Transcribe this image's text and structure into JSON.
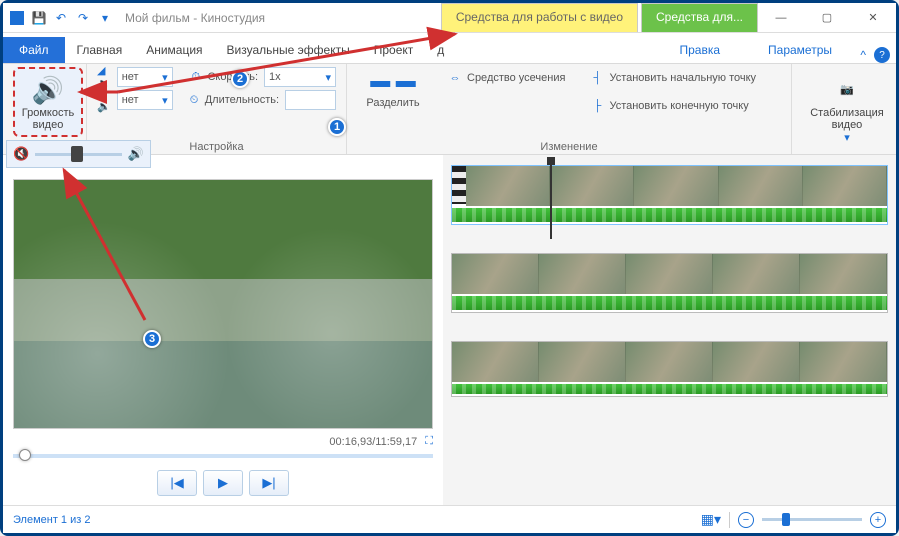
{
  "app": {
    "title": "Мой фильм - Киностудия",
    "context_tab_video": "Средства для работы с видео",
    "context_tab_more": "Средства для...",
    "win_min": "—",
    "win_max": "▢",
    "win_close": "✕"
  },
  "menu": {
    "file": "Файл",
    "home": "Главная",
    "anim": "Анимация",
    "vfx": "Визуальные эффекты",
    "project": "Проект",
    "d": "д",
    "edit": "Правка",
    "params": "Параметры",
    "collapse": "^"
  },
  "ribbon": {
    "volume_btn": "Громкость\nвидео",
    "fade_in": "нет",
    "fade_out": "нет",
    "speed_label": "Скорость:",
    "speed_value": "1x",
    "duration_label": "Длительность:",
    "duration_value": "",
    "split": "Разделить",
    "trim_tool": "Средство усечения",
    "set_start": "Установить начальную точку",
    "set_end": "Установить конечную точку",
    "stabilize": "Стабилизация\nвидео",
    "grp_setup": "Настройка",
    "grp_edit": "Изменение"
  },
  "annotations": {
    "n1": "1",
    "n2": "2",
    "n3": "3"
  },
  "preview": {
    "position": "00:16,93/11:59,17",
    "prev": "|◀",
    "play": "▶",
    "next": "▶|"
  },
  "status": {
    "text": "Элемент 1 из 2",
    "minus": "−",
    "plus": "+"
  },
  "volpop": {
    "mute_icon": "🔇",
    "loud_icon": "🔊"
  }
}
